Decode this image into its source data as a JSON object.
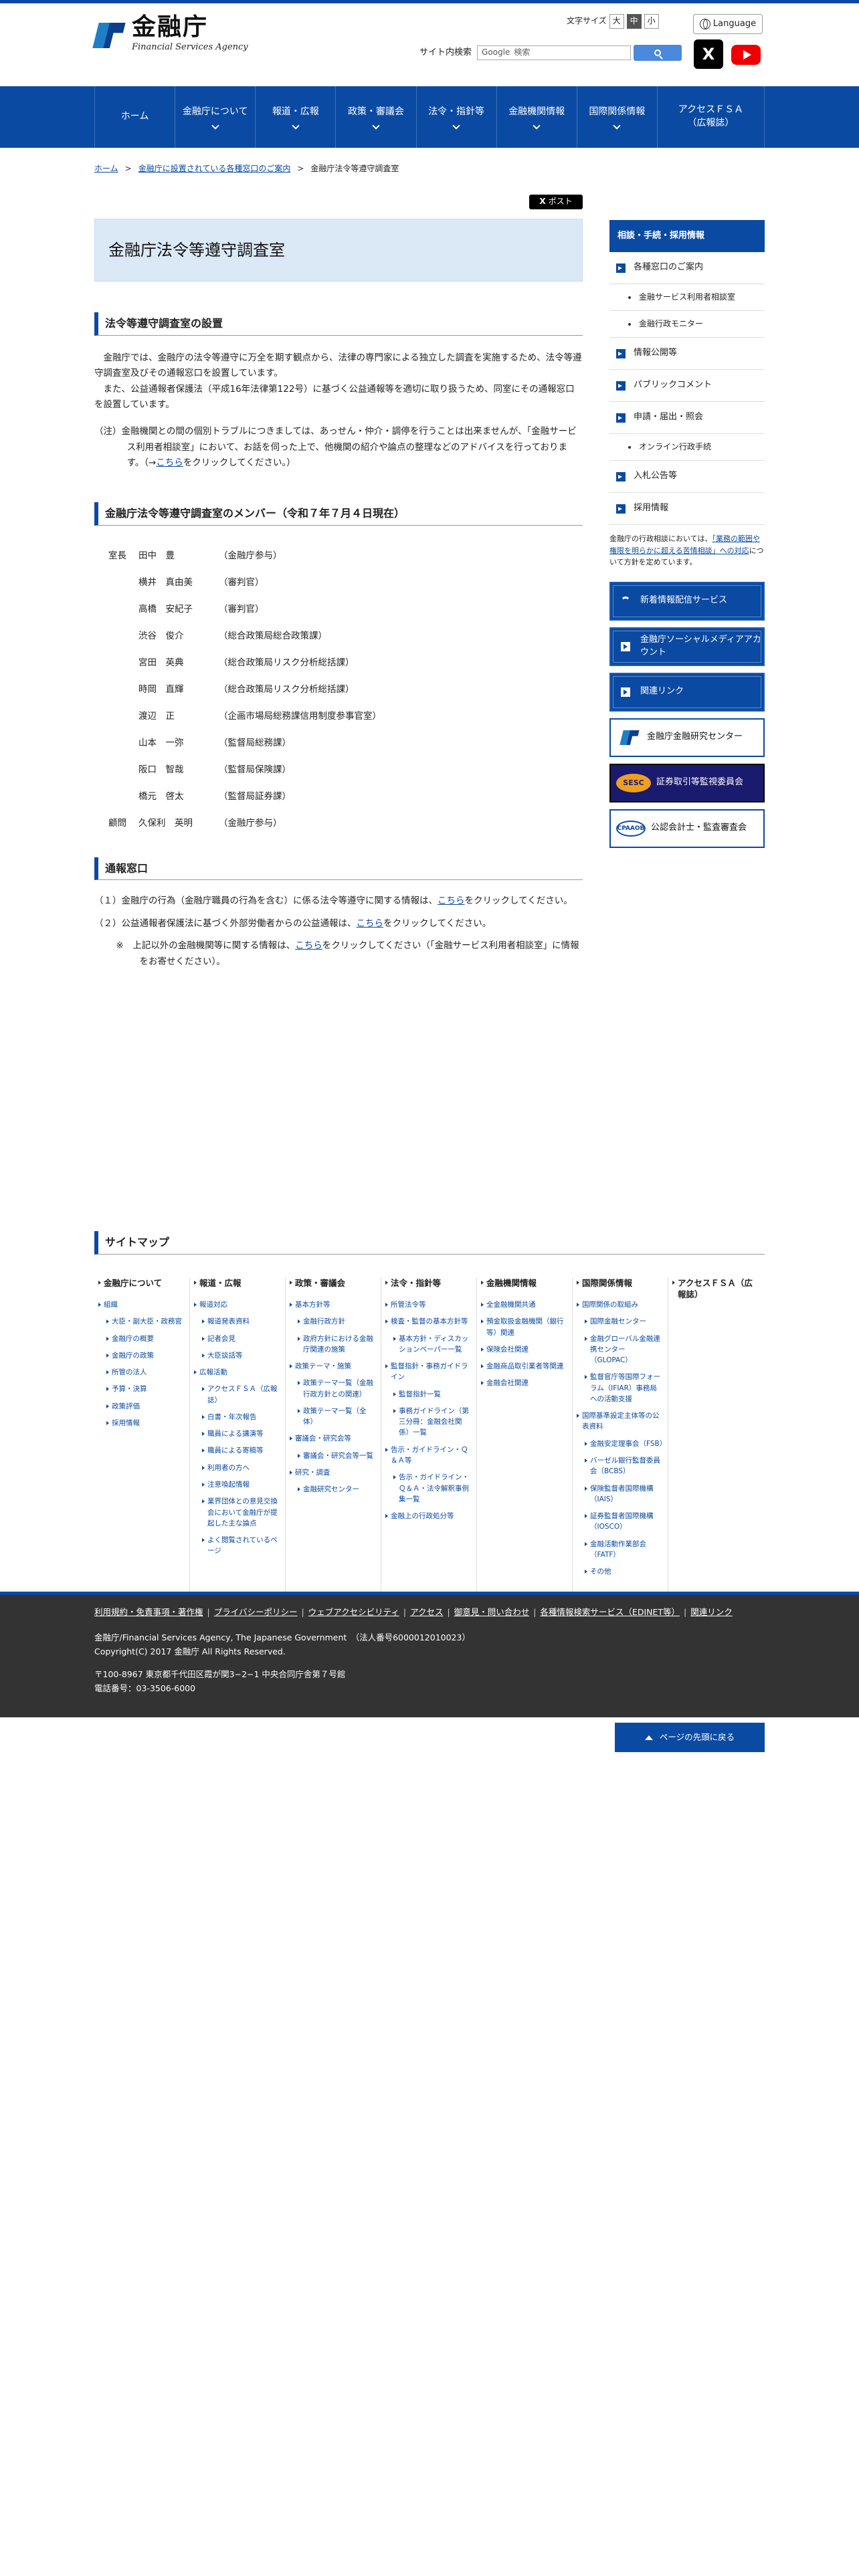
{
  "header": {
    "logo_jp": "金融庁",
    "logo_en": "Financial Services Agency",
    "fontsize_label": "文字サイズ",
    "fontsize_options": [
      "大",
      "中",
      "小"
    ],
    "language_label": "Language",
    "search_label": "サイト内検索",
    "search_placeholder": "検索",
    "search_brand": "Google",
    "x_label": "X"
  },
  "nav": [
    {
      "label": "ホーム",
      "dropdown": false
    },
    {
      "label": "金融庁について",
      "dropdown": true
    },
    {
      "label": "報道・広報",
      "dropdown": true
    },
    {
      "label": "政策・審議会",
      "dropdown": true
    },
    {
      "label": "法令・指針等",
      "dropdown": true
    },
    {
      "label": "金融機関情報",
      "dropdown": true
    },
    {
      "label": "国際関係情報",
      "dropdown": true
    },
    {
      "label": "アクセスＦＳＡ（広報誌）",
      "dropdown": false
    }
  ],
  "breadcrumb": [
    "ホーム",
    "金融庁に設置されている各種窓口のご案内",
    "金融庁法令等遵守調査室"
  ],
  "tweet_label": "ポスト",
  "page_title": "金融庁法令等遵守調査室",
  "section1": {
    "heading": "法令等遵守調査室の設置",
    "p1": "金融庁では、金融庁の法令等遵守に万全を期す観点から、法律の専門家による独立した調査を実施するため、法令等遵守調査室及びその通報窓口を設置しています。",
    "p2": "また、公益通報者保護法（平成16年法律第122号）に基づく公益通報等を適切に取り扱うため、同室にその通報窓口を設置しています。",
    "note_pre": "（注）金融機関との間の個別トラブルにつきましては、あっせん・仲介・調停を行うことは出来ませんが、「金融サービス利用者相談室」において、お話を伺った上で、他機関の紹介や論点の整理などのアドバイスを行っております。（→",
    "note_link": "こちら",
    "note_post": "をクリックしてください。）"
  },
  "section2": {
    "heading": "金融庁法令等遵守調査室のメンバー（令和７年７月４日現在）",
    "members": [
      {
        "role": "室長",
        "name": "田中　豊",
        "post": "（金融庁参与）"
      },
      {
        "role": "",
        "name": "横井　真由美",
        "post": "（審判官）"
      },
      {
        "role": "",
        "name": "高橋　安紀子",
        "post": "（審判官）"
      },
      {
        "role": "",
        "name": "渋谷　俊介",
        "post": "（総合政策局総合政策課）"
      },
      {
        "role": "",
        "name": "宮田　英典",
        "post": "（総合政策局リスク分析総括課）"
      },
      {
        "role": "",
        "name": "時岡　直輝",
        "post": "（総合政策局リスク分析総括課）"
      },
      {
        "role": "",
        "name": "渡辺　正",
        "post": "（企画市場局総務課信用制度参事官室）"
      },
      {
        "role": "",
        "name": "山本　一弥",
        "post": "（監督局総務課）"
      },
      {
        "role": "",
        "name": "阪口　智哉",
        "post": "（監督局保険課）"
      },
      {
        "role": "",
        "name": "橋元　啓太",
        "post": "（監督局証券課）"
      },
      {
        "role": "顧問",
        "name": "久保利　英明",
        "post": "（金融庁参与）"
      }
    ]
  },
  "section3": {
    "heading": "通報窓口",
    "r1_pre": "（１）金融庁の行為（金融庁職員の行為を含む）に係る法令等遵守に関する情報は、",
    "r1_link": "こちら",
    "r1_post": "をクリックしてください。",
    "r2_pre": "（２）公益通報者保護法に基づく外部労働者からの公益通報は、",
    "r2_link": "こちら",
    "r2_post": "をクリックしてください。",
    "r3_pre": "※　上記以外の金融機関等に関する情報は、",
    "r3_link": "こちら",
    "r3_post": "をクリックしてください（「金融サービス利用者相談室」に情報をお寄せください）。"
  },
  "sidebar": {
    "head": "相談・手続・採用情報",
    "items": [
      {
        "label": "各種窓口のご案内",
        "sub": [
          "金融サービス利用者相談室",
          "金融行政モニター"
        ]
      },
      {
        "label": "情報公開等",
        "sub": []
      },
      {
        "label": "パブリックコメント",
        "sub": []
      },
      {
        "label": "申請・届出・照会",
        "sub": [
          "オンライン行政手続"
        ]
      },
      {
        "label": "入札公告等",
        "sub": []
      },
      {
        "label": "採用情報",
        "sub": []
      }
    ],
    "info_pre": "金融庁の行政相談においては、",
    "info_link": "「業務の範囲や権限を明らかに超える苦情相談」への対応",
    "info_post": "について方針を定めています。",
    "banners": {
      "mail": "新着情報配信サービス",
      "social": "金融庁ソーシャルメディアアカウント",
      "links": "関連リンク",
      "research": "金融庁金融研究センター",
      "sesc_logo": "SESC",
      "sesc": "証券取引等監視委員会",
      "cpa_logo": "CPAAOB",
      "cpa": "公認会計士・監査審査会"
    }
  },
  "sitemap": {
    "heading": "サイトマップ",
    "cols": [
      {
        "title": "金融庁について",
        "links": [
          {
            "t": "組織",
            "s": 0
          },
          {
            "t": "大臣・副大臣・政務官",
            "s": 1
          },
          {
            "t": "金融庁の概要",
            "s": 1
          },
          {
            "t": "金融庁の政策",
            "s": 1
          },
          {
            "t": "所管の法人",
            "s": 1
          },
          {
            "t": "予算・決算",
            "s": 1
          },
          {
            "t": "政策評価",
            "s": 1
          },
          {
            "t": "採用情報",
            "s": 1
          }
        ]
      },
      {
        "title": "報道・広報",
        "links": [
          {
            "t": "報道対応",
            "s": 0
          },
          {
            "t": "報道発表資料",
            "s": 1
          },
          {
            "t": "記者会見",
            "s": 1
          },
          {
            "t": "大臣談話等",
            "s": 1
          },
          {
            "t": "広報活動",
            "s": 0
          },
          {
            "t": "アクセスＦＳＡ（広報誌）",
            "s": 1
          },
          {
            "t": "白書・年次報告",
            "s": 1
          },
          {
            "t": "職員による講演等",
            "s": 1
          },
          {
            "t": "職員による寄稿等",
            "s": 1
          },
          {
            "t": "利用者の方へ",
            "s": 1
          },
          {
            "t": "注意喚起情報",
            "s": 1
          },
          {
            "t": "業界団体との意見交換会において金融庁が提起した主な論点",
            "s": 1
          },
          {
            "t": "よく閲覧されているページ",
            "s": 1
          }
        ]
      },
      {
        "title": "政策・審議会",
        "links": [
          {
            "t": "基本方針等",
            "s": 0
          },
          {
            "t": "金融行政方針",
            "s": 1
          },
          {
            "t": "政府方針における金融庁関連の施策",
            "s": 1
          },
          {
            "t": "政策テーマ・施策",
            "s": 0
          },
          {
            "t": "政策テーマ一覧（金融行政方針との関連）",
            "s": 1
          },
          {
            "t": "政策テーマ一覧（全体）",
            "s": 1
          },
          {
            "t": "審議会・研究会等",
            "s": 0
          },
          {
            "t": "審議会・研究会等一覧",
            "s": 1
          },
          {
            "t": "研究・調査",
            "s": 0
          },
          {
            "t": "金融研究センター",
            "s": 1
          }
        ]
      },
      {
        "title": "法令・指針等",
        "links": [
          {
            "t": "所管法令等",
            "s": 0
          },
          {
            "t": "検査・監督の基本方針等",
            "s": 0
          },
          {
            "t": "基本方針・ディスカッションペーパー一覧",
            "s": 1
          },
          {
            "t": "監督指針・事務ガイドライン",
            "s": 0
          },
          {
            "t": "監督指針一覧",
            "s": 1
          },
          {
            "t": "事務ガイドライン（第三分冊：金融会社関係）一覧",
            "s": 1
          },
          {
            "t": "告示・ガイドライン・Ｑ＆Ａ等",
            "s": 0
          },
          {
            "t": "告示・ガイドライン・Ｑ＆Ａ・法令解釈事例集一覧",
            "s": 1
          },
          {
            "t": "金融上の行政処分等",
            "s": 0
          }
        ]
      },
      {
        "title": "金融機関情報",
        "links": [
          {
            "t": "全金融機関共通",
            "s": 0
          },
          {
            "t": "預金取扱金融機関（銀行等）関連",
            "s": 0
          },
          {
            "t": "保険会社関連",
            "s": 0
          },
          {
            "t": "金融商品取引業者等関連",
            "s": 0
          },
          {
            "t": "金融会社関連",
            "s": 0
          }
        ]
      },
      {
        "title": "国際関係情報",
        "links": [
          {
            "t": "国際関係の取組み",
            "s": 0
          },
          {
            "t": "国際金融センター",
            "s": 1
          },
          {
            "t": "金融グローバル金融連携センター（GLOPAC）",
            "s": 1
          },
          {
            "t": "監督官庁等国際フォーラム（IFIAR）事務局への活動支援",
            "s": 1
          },
          {
            "t": "国際基準設定主体等の公表資料",
            "s": 0
          },
          {
            "t": "金融安定理事会（FSB）",
            "s": 1
          },
          {
            "t": "バーゼル銀行監督委員会（BCBS）",
            "s": 1
          },
          {
            "t": "保険監督者国際機構（IAIS）",
            "s": 1
          },
          {
            "t": "証券監督者国際機構（IOSCO）",
            "s": 1
          },
          {
            "t": "金融活動作業部会（FATF）",
            "s": 1
          },
          {
            "t": "その他",
            "s": 1
          }
        ]
      },
      {
        "title": "アクセスＦＳＡ（広報誌）",
        "links": []
      }
    ]
  },
  "pagetop_label": "ページの先頭に戻る",
  "footer": {
    "links": [
      "利用規約・免責事項・著作権",
      "プライバシーポリシー",
      "ウェブアクセシビリティ",
      "アクセス",
      "御意見・問い合わせ",
      "各種情報検索サービス（EDINET等）",
      "関連リンク"
    ],
    "copy1": "金融庁/Financial Services Agency, The Japanese Government　（法人番号6000012010023）",
    "copy2": "Copyright(C) 2017 金融庁 All Rights Reserved.",
    "addr1": "〒100-8967 東京都千代田区霞が関3−2−1 中央合同庁舎第７号館",
    "addr2": "電話番号：03-3506-6000"
  }
}
